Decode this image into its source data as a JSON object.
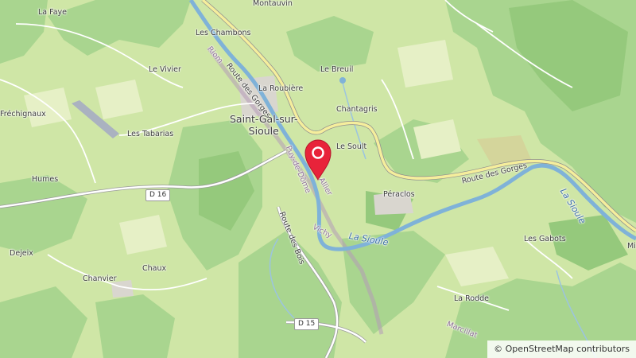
{
  "map": {
    "places": {
      "la_faye": "La Faye",
      "montauvin": "Montauvin",
      "les_chambons": "Les Chambons",
      "le_vivier": "Le Vivier",
      "le_breuil": "Le Breuil",
      "la_roubiere": "La Roubière",
      "frechignaux": "Fréchignaux",
      "saint_gal_line1": "Saint-Gal-sur-",
      "saint_gal_line2": "Sioule",
      "chantagris": "Chantagris",
      "les_tabarias": "Les Tabarias",
      "le_soult": "Le Soult",
      "humes": "Humes",
      "peraclos": "Péraclos",
      "les_gabots": "Les Gabots",
      "dejeix": "Dejeix",
      "chaux": "Chaux",
      "chanvier": "Chanvier",
      "la_rodde": "La Rodde",
      "mi": "Mi"
    },
    "roads": {
      "route_des_gorges_north": "Route des Gorges",
      "route_des_gorges_east": "Route des Gorges",
      "route_des_bois": "Route des Bois",
      "d16": "D 16",
      "d15": "D 15"
    },
    "admin": {
      "riom": "Riom",
      "puy_de_dome": "Puy-de-Dôme",
      "allier": "Allier",
      "vichy": "Vichy",
      "marcillat": "Marcillat"
    },
    "water": {
      "la_sioule_center": "La Sioule",
      "la_sioule_east": "La Sioule"
    }
  },
  "attribution": {
    "symbol": "©",
    "text": "OpenStreetMap contributors"
  },
  "colors": {
    "meadow": "#cfe6a6",
    "forest": "#a9d58f",
    "dark_forest": "#95c97c",
    "field": "#e6f0c6",
    "river": "#7fb2d8",
    "road_yellow": "#f5ee9c",
    "road_white": "#ffffff",
    "boundary": "#b59ab8",
    "marker": "#e8233a"
  }
}
